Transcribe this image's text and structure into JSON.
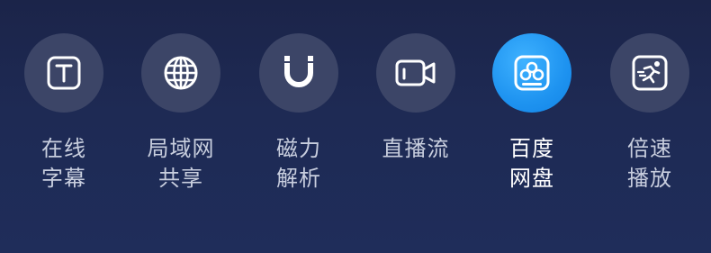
{
  "tools": [
    {
      "icon": "text-subtitle-icon",
      "line1": "在线",
      "line2": "字幕",
      "active": false
    },
    {
      "icon": "globe-icon",
      "line1": "局域网",
      "line2": "共享",
      "active": false
    },
    {
      "icon": "magnet-icon",
      "line1": "磁力",
      "line2": "解析",
      "active": false
    },
    {
      "icon": "video-camera-icon",
      "line1": "直播流",
      "line2": "",
      "active": false
    },
    {
      "icon": "baidu-cloud-icon",
      "line1": "百度",
      "line2": "网盘",
      "active": true
    },
    {
      "icon": "speed-runner-icon",
      "line1": "倍速",
      "line2": "播放",
      "active": false
    }
  ],
  "colors": {
    "accent": "#1e93f0",
    "circle_bg": "#3c4567",
    "label": "#c8cede",
    "label_active": "#ffffff"
  }
}
